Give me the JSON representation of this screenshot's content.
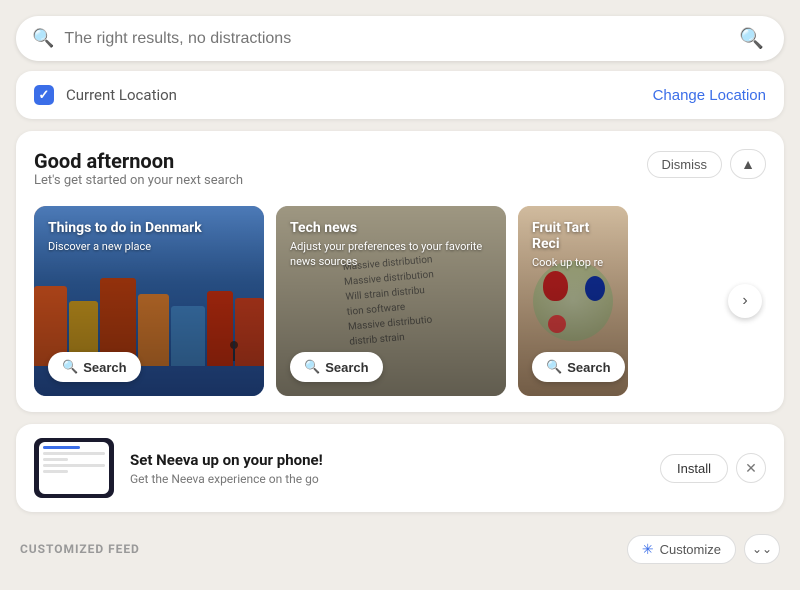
{
  "search": {
    "placeholder": "The right results, no distractions"
  },
  "location": {
    "label": "Current Location",
    "change_label": "Change Location"
  },
  "greeting": {
    "title": "Good afternoon",
    "subtitle": "Let's get started on your next search",
    "dismiss_label": "Dismiss",
    "collapse_icon": "▲"
  },
  "cards": [
    {
      "title": "Things to do in Denmark",
      "desc": "Discover a new place",
      "search_label": "Search",
      "type": "denmark"
    },
    {
      "title": "Tech news",
      "desc": "Adjust your preferences to your favorite news sources",
      "search_label": "Search",
      "type": "technews"
    },
    {
      "title": "Fruit Tart Reci",
      "desc": "Cook up top re",
      "search_label": "Search",
      "type": "fruittart"
    }
  ],
  "next_btn": "›",
  "promo": {
    "title": "Set Neeva up on your phone!",
    "desc": "Get the Neeva experience on the go",
    "install_label": "Install",
    "close_icon": "✕"
  },
  "feed": {
    "label": "CUSTOMIZED FEED",
    "customize_label": "Customize",
    "expand_icon": "⌄⌄"
  }
}
